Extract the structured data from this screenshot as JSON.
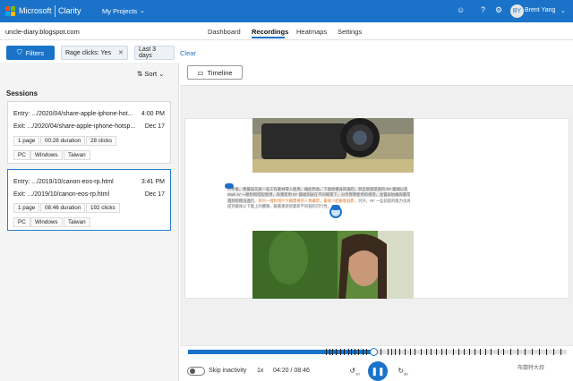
{
  "brand": {
    "company": "Microsoft",
    "product": "Clarity",
    "projects_label": "My Projects"
  },
  "user": {
    "initials": "BY",
    "name": "Brent Yang"
  },
  "site": "uncle-diary.blogspot.com",
  "nav": {
    "tabs": [
      "Dashboard",
      "Recordings",
      "Heatmaps",
      "Settings"
    ],
    "active": "Recordings"
  },
  "filters": {
    "button": "Filters",
    "chips": [
      "Rage clicks: Yes",
      "Last 3 days"
    ],
    "clear": "Clear"
  },
  "sort_label": "Sort",
  "sessions": {
    "title": "Sessions",
    "items": [
      {
        "entry": "Entry: .../2020/04/share-apple-iphone-hot...",
        "entry_time": "4:00 PM",
        "exit": "Exit: .../2020/04/share-apple-iphone-hotsp...",
        "exit_date": "Dec 17",
        "badges": [
          "1 page",
          "00:28 duration",
          "28 clicks"
        ],
        "tags": [
          "PC",
          "Windows",
          "Taiwan"
        ]
      },
      {
        "entry": "Entry: .../2019/10/canon-eos-rp.html",
        "entry_time": "3:41 PM",
        "exit": "Exit: .../2019/10/canon-eos-rp.html",
        "exit_date": "Dec 17",
        "badges": [
          "1 page",
          "08:46 duration",
          "192 clicks"
        ],
        "tags": [
          "PC",
          "Windows",
          "Taiwan"
        ]
      }
    ]
  },
  "timeline_label": "Timeline",
  "article": {
    "part1": "入手後，我嘗試先將一些工作素材帶入使用，藉此熟悉。下面從機身的操控，到出現感受感的 RF 鏡頭以及 Mark IV 一路對照搭配使用，再重新用 EF 鏡頭測試在不同場景下，分享實際使用的感受，並嘗試拍攝與最常遇到的情況進行",
    "part2": "。系列一樣對用戶大概需要的人像攝影，最後介紹動態錄影，",
    "part3": "另外，RF 一些前提的能力也再提到最後以下能上的體驗，跟著重新從最新不同個的可行性。"
  },
  "playback": {
    "skip_inactivity": "Skip inactivity",
    "speed": "1x",
    "time": "04:20 / 08:46",
    "back": "10",
    "forward": "30",
    "progress": 0.49,
    "watermark": "布蘭特大叔"
  },
  "colors": {
    "accent": "#1a73c8"
  }
}
